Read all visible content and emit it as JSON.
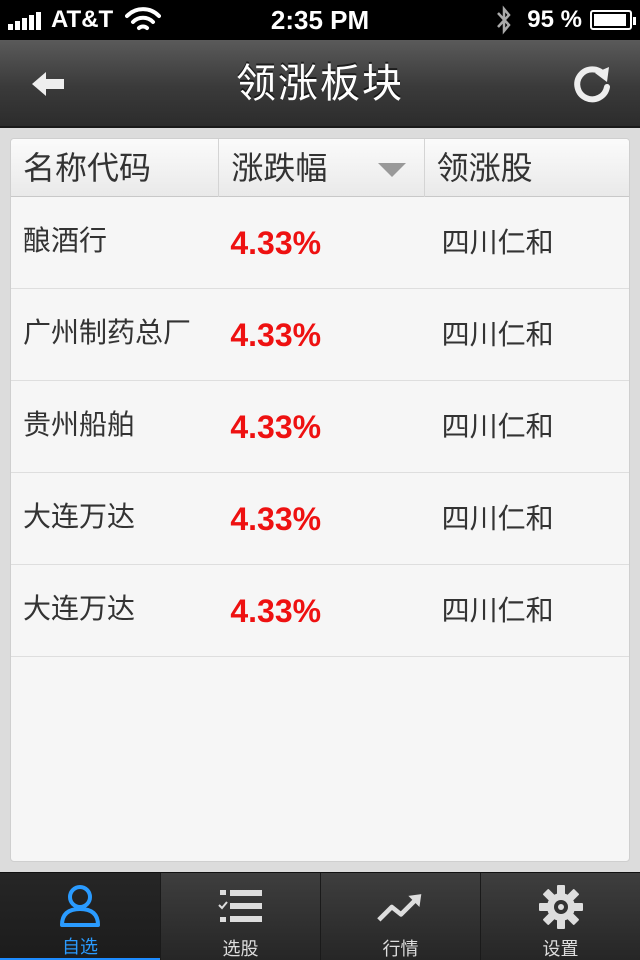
{
  "status": {
    "carrier": "AT&T",
    "time": "2:35 PM",
    "battery_pct": "95 %",
    "battery_level": 0.95,
    "signal_bars": 5
  },
  "nav": {
    "title": "领涨板块",
    "back_icon": "arrow-left-icon",
    "refresh_icon": "refresh-icon"
  },
  "table": {
    "headers": [
      "名称代码",
      "涨跌幅",
      "领涨股"
    ],
    "sort_icon": "sort-down-icon",
    "rows": [
      {
        "name": "酿酒行",
        "change": "4.33%",
        "leader": "四川仁和"
      },
      {
        "name": "广州制药总厂",
        "change": "4.33%",
        "leader": "四川仁和"
      },
      {
        "name": "贵州船舶",
        "change": "4.33%",
        "leader": "四川仁和"
      },
      {
        "name": "大连万达",
        "change": "4.33%",
        "leader": "四川仁和"
      },
      {
        "name": "大连万达",
        "change": "4.33%",
        "leader": "四川仁和"
      }
    ]
  },
  "tabs": [
    {
      "label": "自选",
      "icon": "user-icon",
      "active": true
    },
    {
      "label": "选股",
      "icon": "checklist-icon",
      "active": false
    },
    {
      "label": "行情",
      "icon": "trend-up-icon",
      "active": false
    },
    {
      "label": "设置",
      "icon": "gear-icon",
      "active": false
    }
  ],
  "colors": {
    "up_red": "#ee1111",
    "active_blue": "#1e8cff"
  }
}
